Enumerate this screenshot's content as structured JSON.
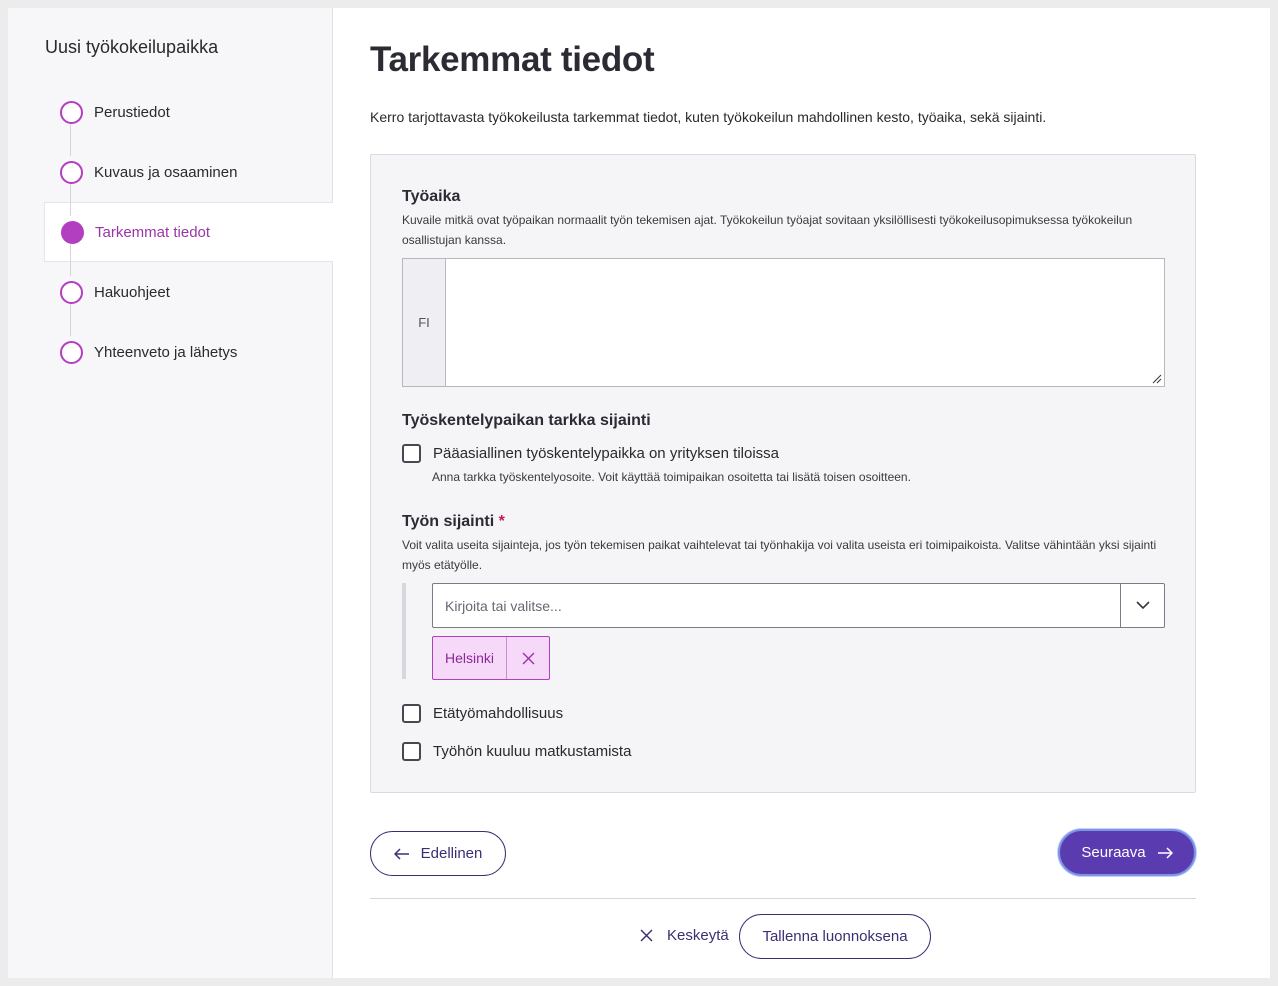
{
  "sidebar": {
    "title": "Uusi työkokeilupaikka",
    "steps": [
      {
        "label": "Perustiedot",
        "state": "incomplete"
      },
      {
        "label": "Kuvaus ja osaaminen",
        "state": "incomplete"
      },
      {
        "label": "Tarkemmat tiedot",
        "state": "active"
      },
      {
        "label": "Hakuohjeet",
        "state": "incomplete"
      },
      {
        "label": "Yhteenveto ja lähetys",
        "state": "incomplete"
      }
    ]
  },
  "main": {
    "title": "Tarkemmat tiedot",
    "intro": "Kerro tarjottavasta työkokeilusta tarkemmat tiedot, kuten työkokeilun mahdollinen kesto, työaika, sekä sijainti."
  },
  "worktime": {
    "heading": "Työaika",
    "help": "Kuvaile mitkä ovat työpaikan normaalit työn tekemisen ajat. Työkokeilun työajat sovitaan yksilöllisesti työkokeilusopimuksessa työkokeilun osallistujan kanssa.",
    "lang": "FI",
    "value": ""
  },
  "exact_location": {
    "heading": "Työskentelypaikan tarkka sijainti",
    "checkbox_label": "Pääasiallinen työskentelypaikka on yrityksen tiloissa",
    "checkbox_help": "Anna tarkka työskentelyosoite. Voit käyttää toimipaikan osoitetta tai lisätä toisen osoitteen.",
    "checked": false
  },
  "work_location": {
    "heading": "Työn sijainti",
    "required_mark": "*",
    "help": "Voit valita useita sijainteja, jos työn tekemisen paikat vaihtelevat tai työnhakija voi valita useista eri toimipaikoista. Valitse vähintään yksi sijainti myös etätyölle.",
    "placeholder": "Kirjoita tai valitse...",
    "selected": [
      "Helsinki"
    ]
  },
  "options": {
    "remote": {
      "label": "Etätyömahdollisuus",
      "checked": false
    },
    "travel": {
      "label": "Työhön kuuluu matkustamista",
      "checked": false
    }
  },
  "nav": {
    "prev": "Edellinen",
    "next": "Seuraava",
    "cancel": "Keskeytä",
    "save_draft": "Tallenna luonnoksena"
  },
  "colors": {
    "accent": "#b23fbf",
    "primary": "#5b3cb0",
    "dark": "#3d2d74"
  },
  "icons": [
    "arrow-left-icon",
    "arrow-right-icon",
    "chevron-down-icon",
    "close-icon"
  ]
}
